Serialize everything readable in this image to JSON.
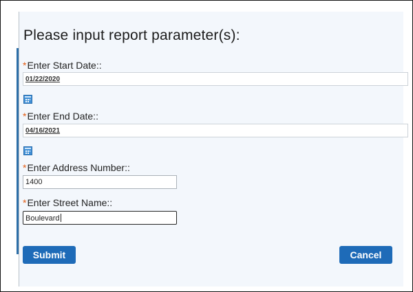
{
  "form": {
    "title": "Please input report parameter(s):",
    "required_marker": "*",
    "fields": [
      {
        "label": "Enter Start Date::",
        "value": "01/22/2020",
        "calendar_icon": "calendar-icon"
      },
      {
        "label": "Enter End Date::",
        "value": "04/16/2021",
        "calendar_icon": "calendar-icon"
      },
      {
        "label": "Enter Address Number::",
        "value": "1400"
      },
      {
        "label": "Enter Street Name::",
        "value": "Boulevard"
      }
    ],
    "submit_label": "Submit",
    "cancel_label": "Cancel"
  },
  "colors": {
    "accent": "#1e6bb8",
    "required": "#e25c14",
    "panel_bg": "#f3f7fc"
  }
}
